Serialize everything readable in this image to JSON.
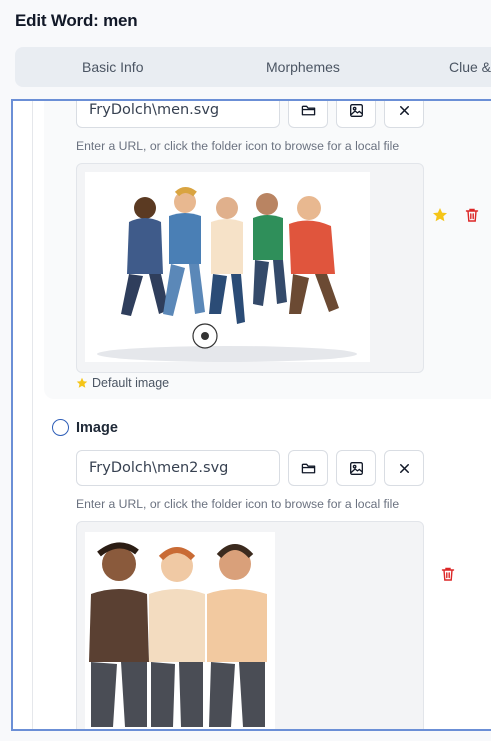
{
  "page": {
    "title": "Edit Word: men"
  },
  "tabs": [
    {
      "label": "Basic Info"
    },
    {
      "label": "Morphemes"
    },
    {
      "label": "Clue &"
    }
  ],
  "images": [
    {
      "url_value": "FryDolch\\men.svg",
      "hint": "Enter a URL, or click the folder icon to browse for a local file",
      "default_label": "Default image",
      "is_default": true
    },
    {
      "label": "Image",
      "url_value": "FryDolch\\men2.svg",
      "hint": "Enter a URL, or click the folder icon to browse for a local file",
      "is_default": false
    }
  ],
  "colors": {
    "accent": "#2f5fb8",
    "star": "#f5c518",
    "delete": "#dc2626",
    "frame_border": "#6b8fd6"
  }
}
